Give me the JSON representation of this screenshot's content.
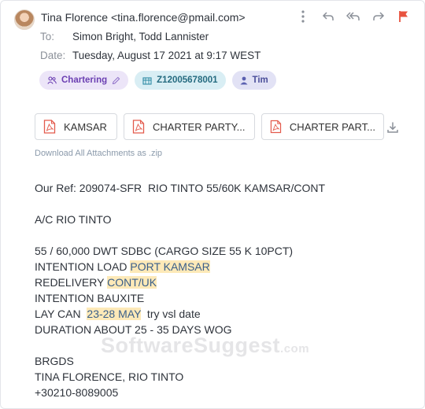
{
  "header": {
    "from": "Tina Florence <tina.florence@pmail.com>",
    "to_label": "To:",
    "to_value": "Simon Bright, Todd Lannister",
    "date_label": "Date:",
    "date_value": "Tuesday, August 17 2021 at 9:17 WEST",
    "toolbar_icons": [
      "more-vertical-icon",
      "reply-icon",
      "reply-all-icon",
      "forward-icon",
      "flag-icon"
    ],
    "flag_color": "#e8533f"
  },
  "tags": [
    {
      "label": "Chartering",
      "icon": "users-icon",
      "extra_icon": "pencil-icon"
    },
    {
      "label": "Z12005678001",
      "icon": "building-icon"
    },
    {
      "label": "Tim",
      "icon": "user-icon"
    }
  ],
  "attachments": [
    {
      "label": "KAMSAR"
    },
    {
      "label": "CHARTER PARTY..."
    },
    {
      "label": "CHARTER PART..."
    }
  ],
  "download_all": "Download All Attachments as .zip",
  "body": {
    "l1": "Our Ref: 209074-SFR  RIO TINTO 55/60K KAMSAR/CONT",
    "l2": "A/C RIO TINTO",
    "l3": "55 / 60,000 DWT SDBC (CARGO SIZE 55 K 10PCT)",
    "l4a": "INTENTION LOAD ",
    "l4b": "PORT KAMSAR",
    "l5a": "REDELIVERY ",
    "l5b": "CONT/UK",
    "l6": "INTENTION BAUXITE",
    "l7a": "LAY CAN  ",
    "l7b": "23-28 MAY",
    "l7c": "  try vsl date",
    "l8": "DURATION ABOUT 25 - 35 DAYS WOG",
    "l9": "BRGDS",
    "l10": "TINA FLORENCE, RIO TINTO",
    "l11": "+30210-8089005"
  },
  "watermark": {
    "main": "SoftwareSuggest",
    "suffix": ".com"
  },
  "colors": {
    "highlight": "#fde9b8",
    "pdf_red": "#e35a4c"
  }
}
